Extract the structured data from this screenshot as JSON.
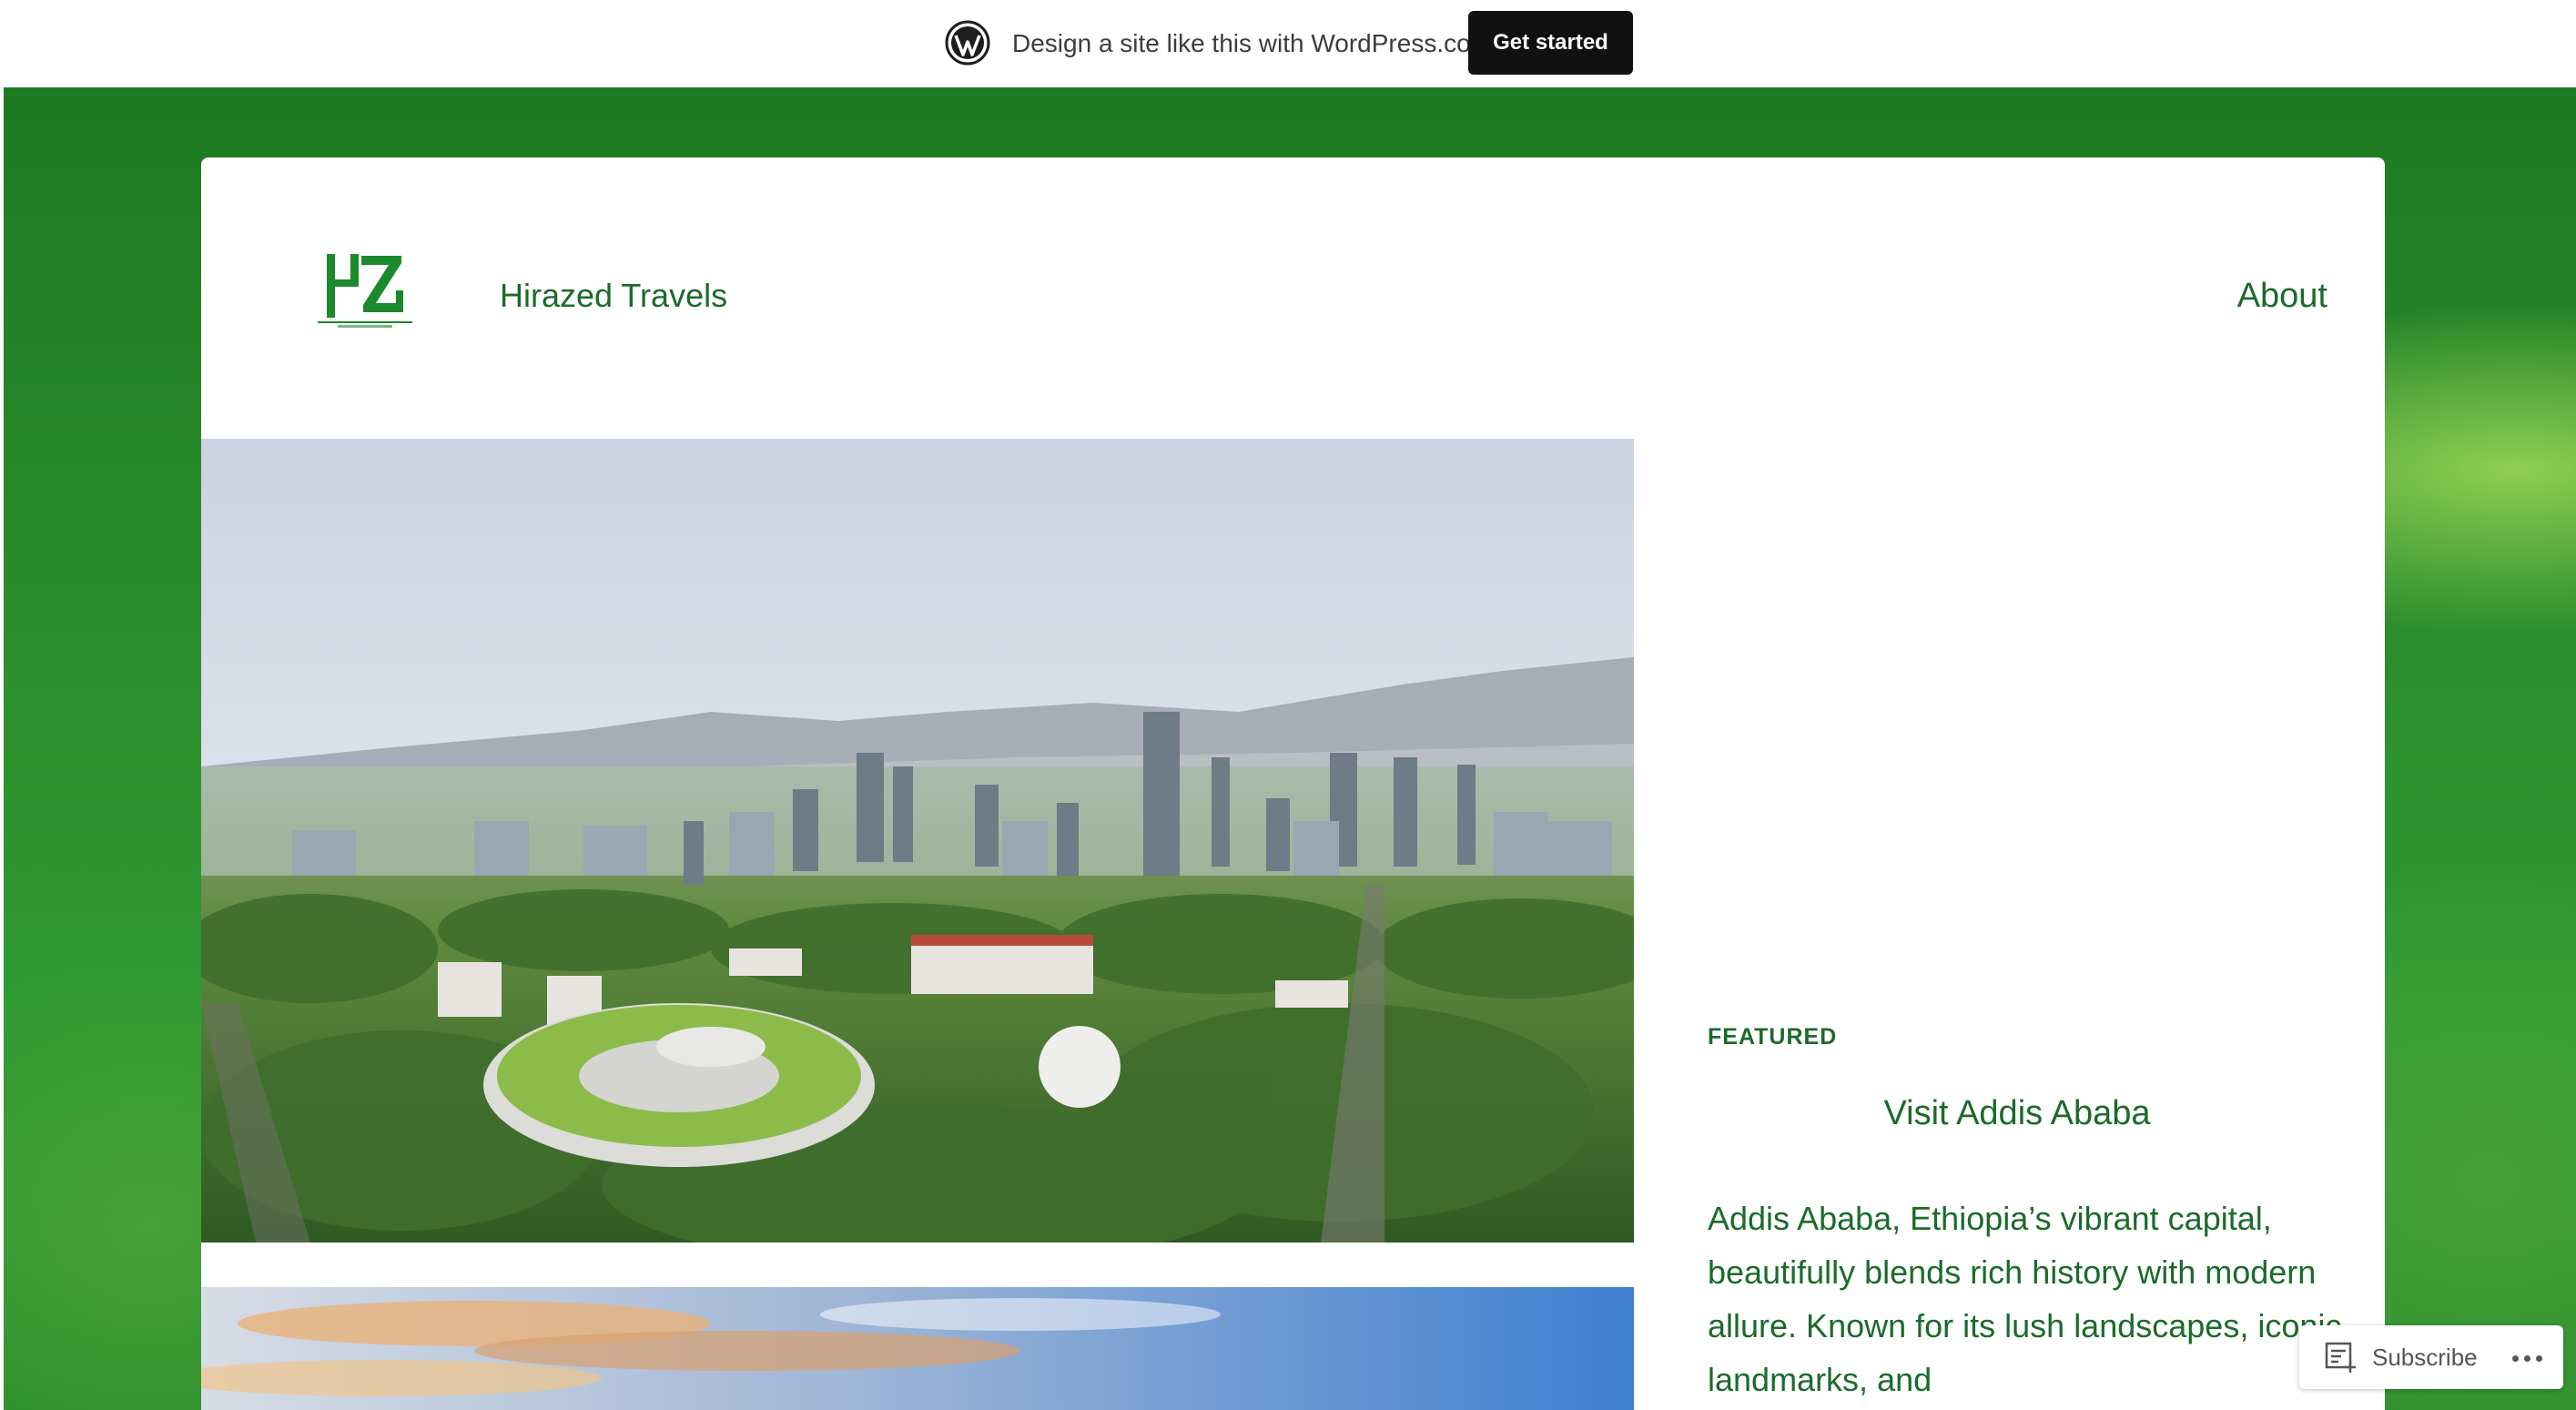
{
  "wp_bar": {
    "logo_icon": "wordpress-logo-icon",
    "promo_text": "Design a site like this with WordPress.com",
    "cta_label": "Get started"
  },
  "site": {
    "logo_icon": "hz-site-logo-icon",
    "logo_text": "HZ",
    "title": "Hirazed Travels",
    "nav": [
      {
        "label": "About"
      }
    ]
  },
  "featured_post": {
    "label": "FEATURED",
    "title": "Visit Addis Ababa",
    "excerpt": "Addis Ababa, Ethiopia’s vibrant capital, beautifully blends rich history with modern allure. Known for its lush landscapes, iconic landmarks, and"
  },
  "subscribe": {
    "icon": "reader-subscribe-icon",
    "label": "Subscribe",
    "more_icon": "ellipsis-icon"
  },
  "colors": {
    "accent_green": "#1a6b2a",
    "button_dark": "#111111",
    "backdrop_green": "#2a8d2c"
  }
}
